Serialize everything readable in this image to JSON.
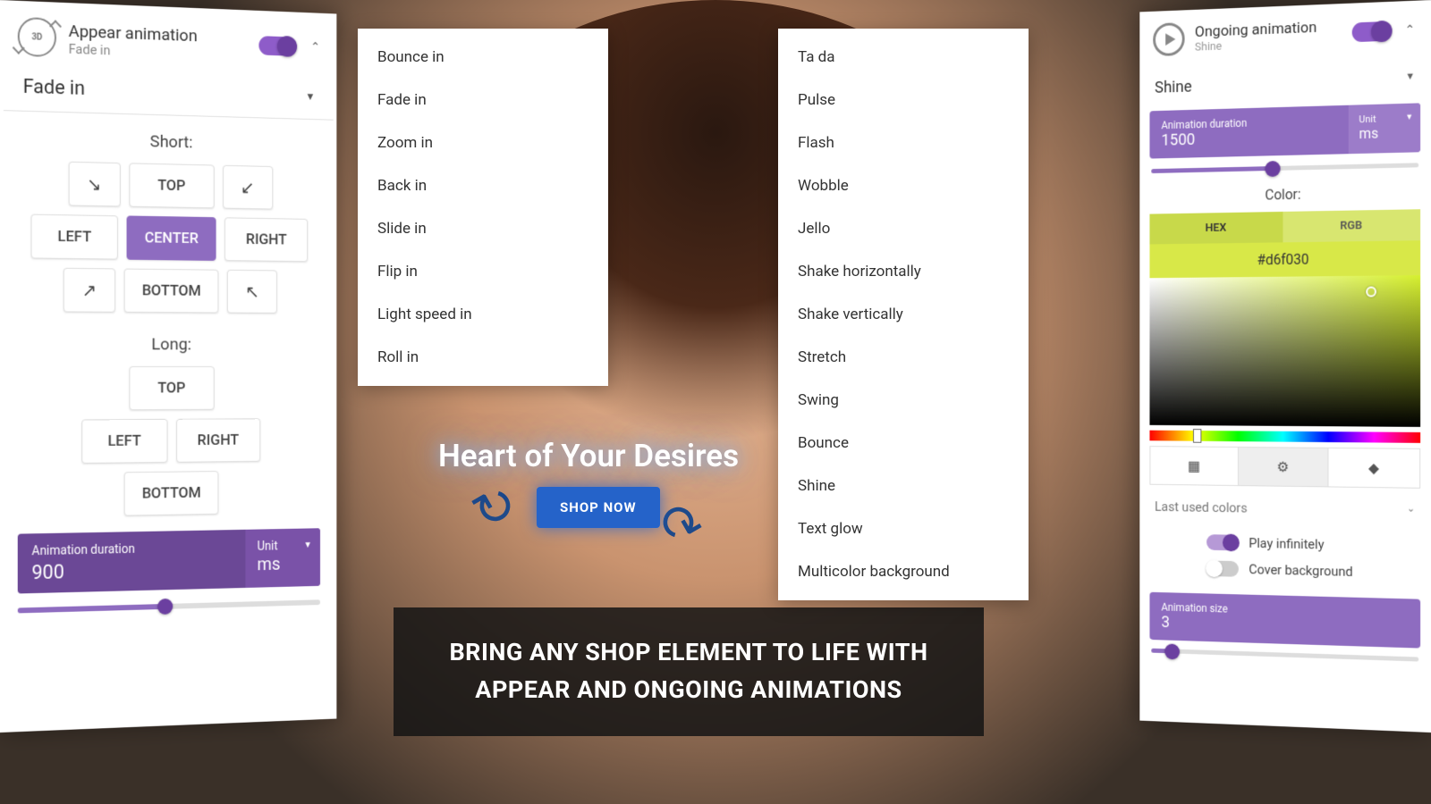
{
  "left": {
    "title": "Appear animation",
    "subtitle": "Fade in",
    "selected": "Fade in",
    "short_label": "Short:",
    "short_grid": {
      "r1": [
        "↘",
        "TOP",
        "↙"
      ],
      "r2": [
        "LEFT",
        "CENTER",
        "RIGHT"
      ],
      "r3": [
        "↗",
        "BOTTOM",
        "↖"
      ]
    },
    "long_label": "Long:",
    "long_grid": {
      "r1": [
        "TOP"
      ],
      "r2": [
        "LEFT",
        "RIGHT"
      ],
      "r3": [
        "BOTTOM"
      ]
    },
    "duration_label": "Animation duration",
    "duration_value": "900",
    "unit_label": "Unit",
    "unit_value": "ms"
  },
  "dropdown1": [
    "Bounce in",
    "Fade in",
    "Zoom in",
    "Back in",
    "Slide in",
    "Flip in",
    "Light speed in",
    "Roll in"
  ],
  "dropdown2": [
    "Ta da",
    "Pulse",
    "Flash",
    "Wobble",
    "Jello",
    "Shake horizontally",
    "Shake vertically",
    "Stretch",
    "Swing",
    "Bounce",
    "Shine",
    "Text glow",
    "Multicolor background"
  ],
  "hero": {
    "headline": "Heart of Your Desires",
    "cta": "SHOP NOW"
  },
  "caption": "BRING ANY SHOP ELEMENT TO LIFE WITH APPEAR AND ONGOING ANIMATIONS",
  "right": {
    "title": "Ongoing animation",
    "subtitle": "Shine",
    "selected": "Shine",
    "duration_label": "Animation duration",
    "duration_value": "1500",
    "unit_label": "Unit",
    "unit_value": "ms",
    "color_label": "Color:",
    "tab_hex": "HEX",
    "tab_rgb": "RGB",
    "hex_value": "#d6f030",
    "last_colors": "Last used colors",
    "play_infinite": "Play infinitely",
    "cover_bg": "Cover background",
    "size_label": "Animation size",
    "size_value": "3"
  },
  "colors": {
    "accent": "#8e6cc0",
    "chart": "#d6f030"
  }
}
